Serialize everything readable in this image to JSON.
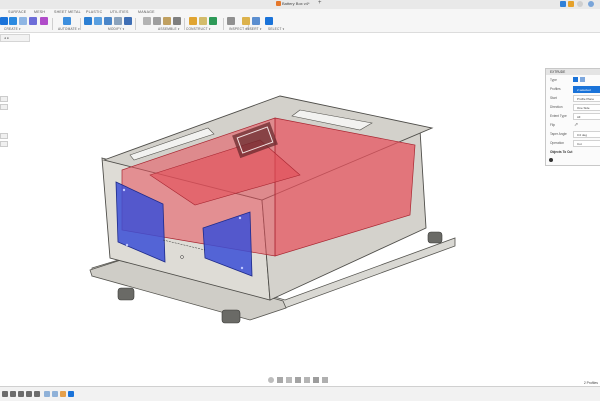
{
  "window": {
    "document_title": "Battery Box v4*"
  },
  "tabs": [
    {
      "label": "SURFACE",
      "active": false
    },
    {
      "label": "MESH",
      "active": false
    },
    {
      "label": "SHEET METAL",
      "active": false
    },
    {
      "label": "PLASTIC",
      "active": false
    },
    {
      "label": "UTILITIES",
      "active": false
    },
    {
      "label": "MANAGE",
      "active": false
    }
  ],
  "toolbar_groups": [
    {
      "label": "CREATE ▾"
    },
    {
      "label": "AUTOMATE ▾"
    },
    {
      "label": "MODIFY ▾"
    },
    {
      "label": "ASSEMBLE ▾"
    },
    {
      "label": "CONSTRUCT ▾"
    },
    {
      "label": "INSPECT ▾"
    },
    {
      "label": "INSERT ▾"
    },
    {
      "label": "SELECT ▾"
    }
  ],
  "extrude_panel": {
    "header": "EXTRUDE",
    "rows": [
      {
        "label": "Type",
        "value": ""
      },
      {
        "label": "Profiles",
        "value": "2 selected",
        "selected": true
      },
      {
        "label": "Start",
        "value": "Profile Plane"
      },
      {
        "label": "Direction",
        "value": "One Side"
      },
      {
        "label": "Extent Type",
        "value": "All"
      },
      {
        "label": "Flip",
        "value": ""
      },
      {
        "label": "Taper Angle",
        "value": "0.0 deg"
      },
      {
        "label": "Operation",
        "value": "Cut"
      },
      {
        "label": "Objects To Cut",
        "value": ""
      }
    ]
  },
  "status_text": "2 Profiles",
  "colors": {
    "cut_profile": "#e8505b",
    "end_face": "#3b4fd6",
    "accent": "#1a73d9",
    "box_metal": "#d8d6d0"
  }
}
